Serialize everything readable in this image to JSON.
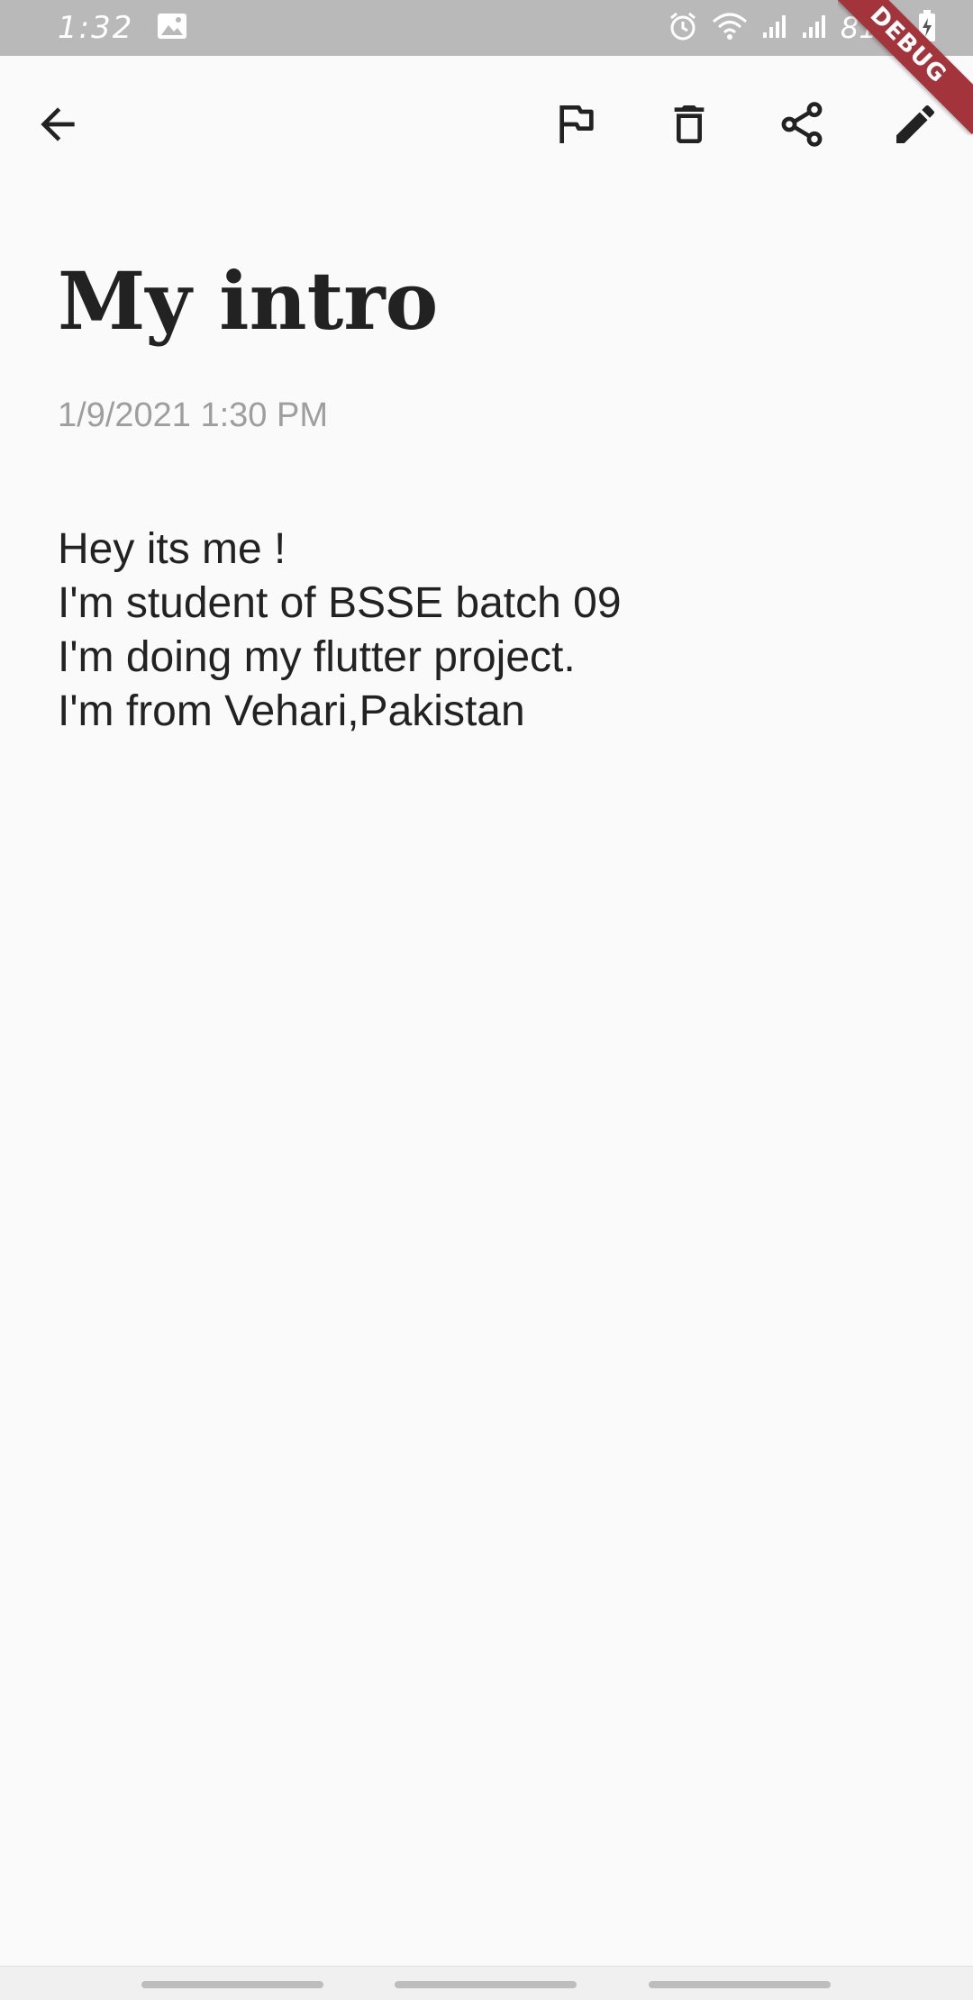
{
  "status_bar": {
    "time": "1:32",
    "battery_percent": "81%",
    "icons": [
      "image-icon",
      "alarm-icon",
      "wifi-icon",
      "signal-icon",
      "signal-icon",
      "battery-charging-icon"
    ]
  },
  "debug_banner": {
    "label": "DEBUG",
    "color": "#a3343b"
  },
  "toolbar": {
    "back_icon": "arrow-back-icon",
    "actions": [
      "flag-icon",
      "delete-icon",
      "share-icon",
      "edit-icon"
    ]
  },
  "note": {
    "title": "My intro",
    "date": "1/9/2021 1:30 PM",
    "body_lines": [
      "Hey its me !",
      "I'm student of BSSE batch 09",
      "I'm doing my flutter project.",
      "I'm from Vehari,Pakistan"
    ]
  },
  "colors": {
    "background": "#fafafa",
    "text": "#222222",
    "date_text": "#9e9e9e",
    "status_bar": "#b9b9b9"
  }
}
